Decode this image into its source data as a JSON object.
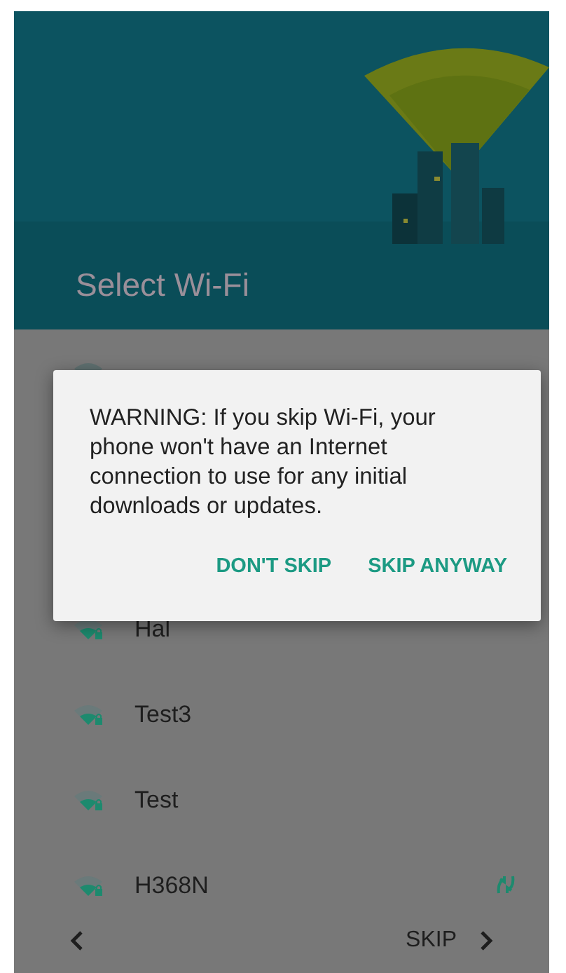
{
  "header": {
    "title": "Select Wi-Fi"
  },
  "networks": [
    {
      "name": "Hal",
      "locked": true,
      "wps": false
    },
    {
      "name": "Test3",
      "locked": true,
      "wps": false
    },
    {
      "name": "Test",
      "locked": true,
      "wps": false
    },
    {
      "name": "H368N",
      "locked": true,
      "wps": true
    }
  ],
  "dialog": {
    "message": "WARNING: If you skip Wi-Fi, your phone won't have an Internet connection to use for any initial downloads or updates.",
    "buttons": [
      "DON'T SKIP",
      "SKIP ANYWAY"
    ]
  },
  "footer": {
    "skip_label": "SKIP"
  }
}
